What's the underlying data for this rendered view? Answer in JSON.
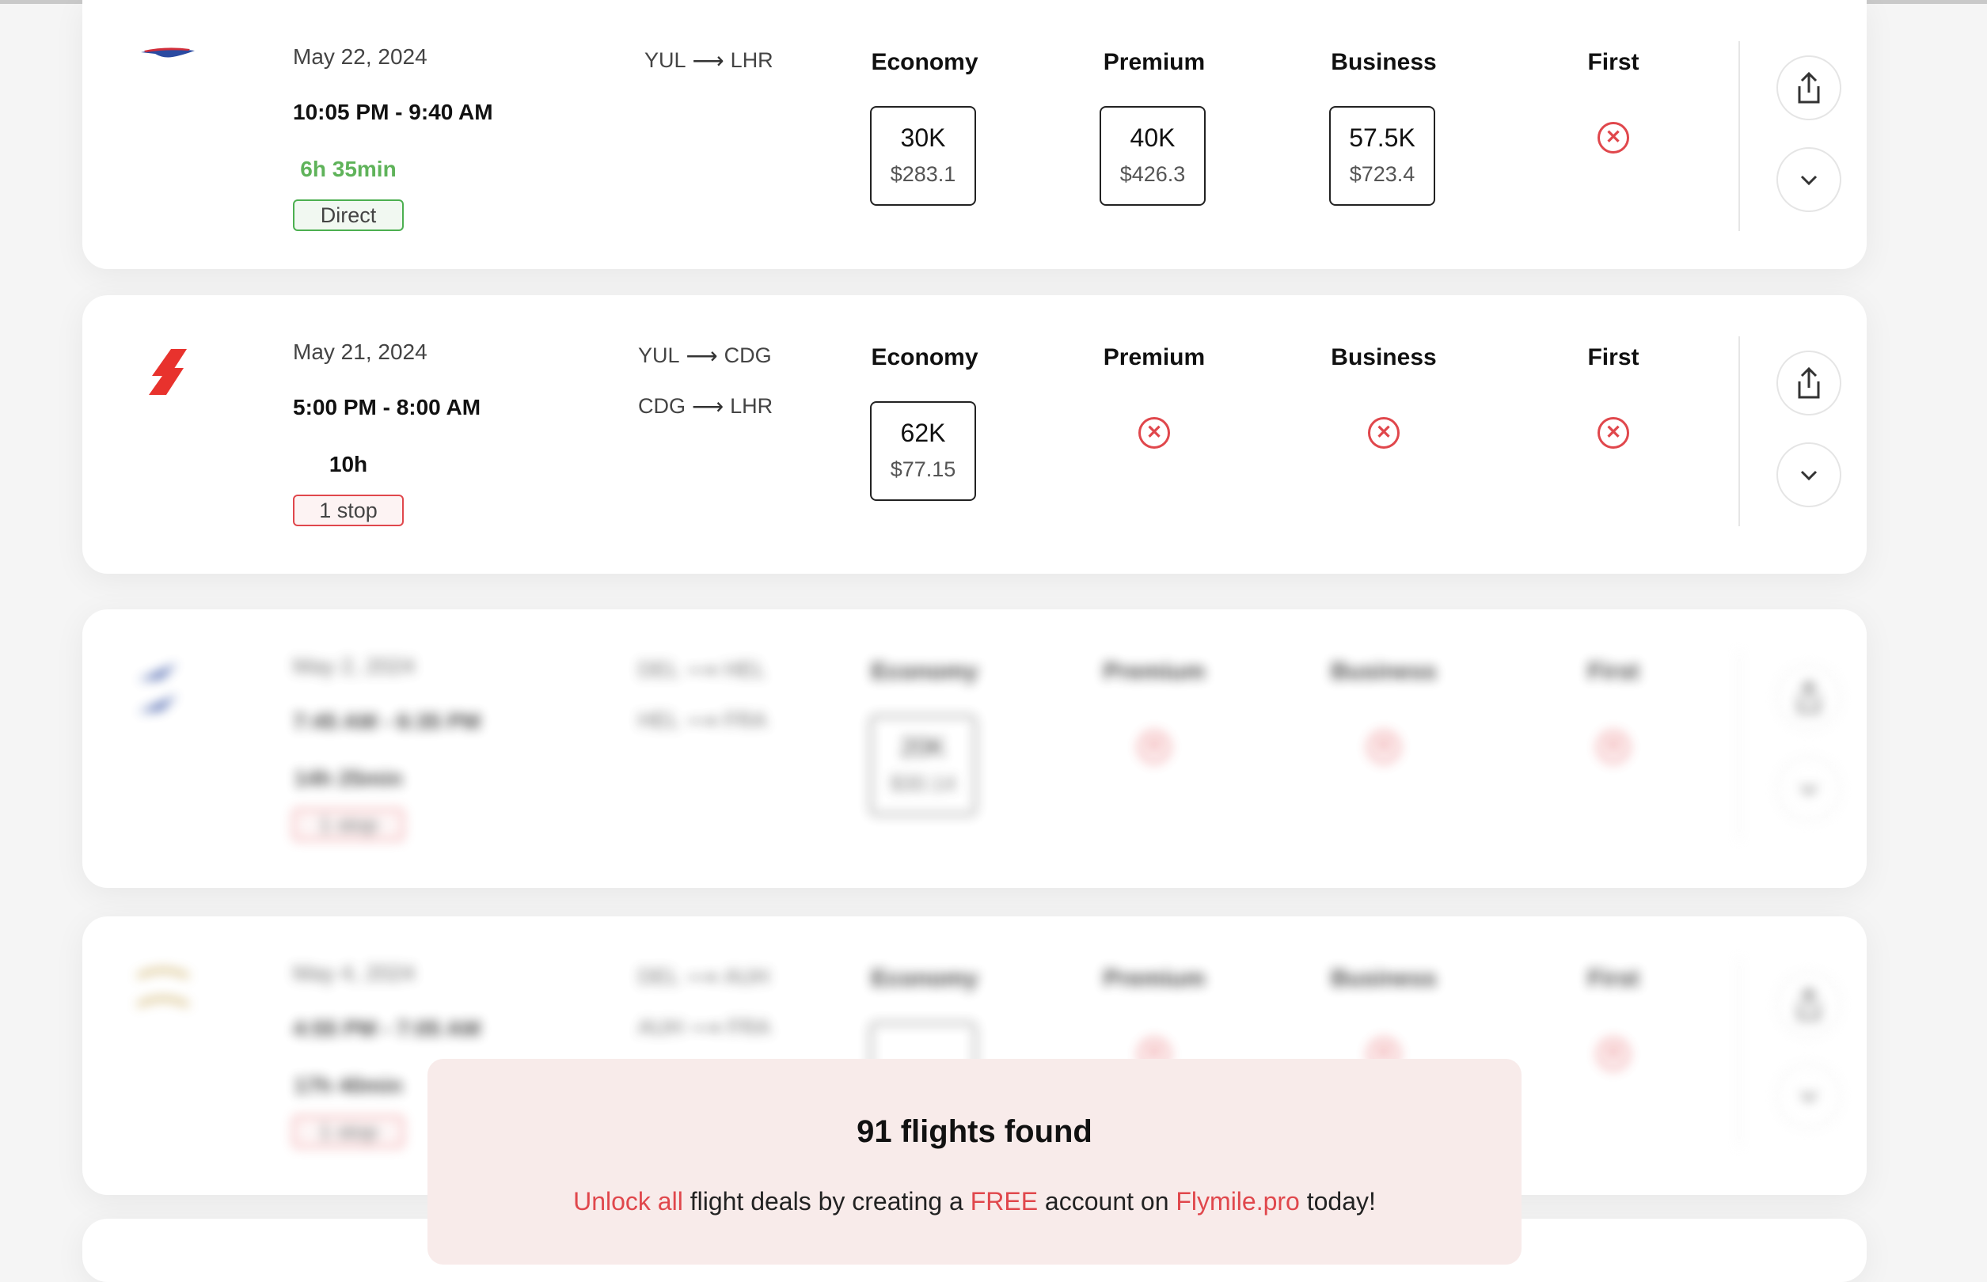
{
  "flights": [
    {
      "airline_logo": "british-airways-logo",
      "date": "May 22, 2024",
      "time": "10:05 PM - 9:40 AM",
      "duration": "6h 35min",
      "stops": "Direct",
      "routes": [
        {
          "from": "YUL",
          "to": "LHR"
        }
      ],
      "classes": [
        {
          "name": "Economy",
          "points": "30K",
          "price": "$283.1",
          "available": true
        },
        {
          "name": "Premium",
          "points": "40K",
          "price": "$426.3",
          "available": true
        },
        {
          "name": "Business",
          "points": "57.5K",
          "price": "$723.4",
          "available": true
        },
        {
          "name": "First",
          "available": false
        }
      ]
    },
    {
      "airline_logo": "air-france-logo",
      "date": "May 21, 2024",
      "time": "5:00 PM - 8:00 AM",
      "duration": "10h",
      "stops": "1 stop",
      "routes": [
        {
          "from": "YUL",
          "to": "CDG"
        },
        {
          "from": "CDG",
          "to": "LHR"
        }
      ],
      "classes": [
        {
          "name": "Economy",
          "points": "62K",
          "price": "$77.15",
          "available": true
        },
        {
          "name": "Premium",
          "available": false
        },
        {
          "name": "Business",
          "available": false
        },
        {
          "name": "First",
          "available": false
        }
      ]
    },
    {
      "airline_logo": "finnair-logo",
      "date": "May 2, 2024",
      "time": "7:45 AM - 6:35 PM",
      "duration": "14h 25min",
      "stops": "1 stop",
      "routes": [
        {
          "from": "DEL",
          "to": "HEL"
        },
        {
          "from": "HEL",
          "to": "FRA"
        }
      ],
      "classes": [
        {
          "name": "Economy",
          "points": "20K",
          "price": "$30.14",
          "available": true
        },
        {
          "name": "Premium",
          "available": false
        },
        {
          "name": "Business",
          "available": false
        },
        {
          "name": "First",
          "available": false
        }
      ]
    },
    {
      "airline_logo": "etihad-logo",
      "date": "May 4, 2024",
      "time": "4:55 PM - 7:05 AM",
      "duration": "17h 40min",
      "stops": "1 stop",
      "routes": [
        {
          "from": "DEL",
          "to": "AUH"
        },
        {
          "from": "AUH",
          "to": "FRA"
        }
      ],
      "classes": [
        {
          "name": "Economy",
          "points": "",
          "price": "",
          "available": true
        },
        {
          "name": "Premium",
          "available": false
        },
        {
          "name": "Business",
          "available": false
        },
        {
          "name": "First",
          "available": false
        }
      ]
    }
  ],
  "icons": {
    "share": "share-icon",
    "expand": "chevron-down-icon",
    "unavailable": "x-circle-icon"
  },
  "colors": {
    "accent_red": "#e0474c",
    "direct_green": "#4caf50",
    "duration_green": "#5fb35a",
    "overlay_bg": "#f8ebea"
  },
  "signup_overlay": {
    "headline": "91 flights found",
    "msg_part1": "Unlock all",
    "msg_part2": " flight deals by creating a ",
    "msg_part3": "FREE",
    "msg_part4": " account on ",
    "msg_part5": "Flymile.pro",
    "msg_part6": " today!"
  }
}
